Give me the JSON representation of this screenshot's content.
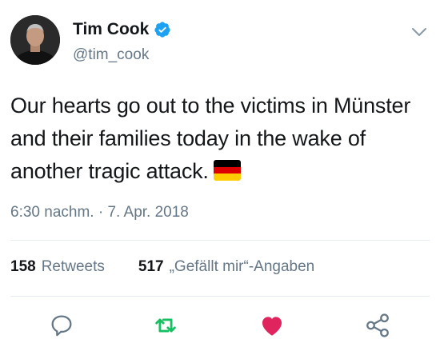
{
  "author": {
    "name": "Tim Cook",
    "handle": "@tim_cook",
    "verified": true
  },
  "tweet": {
    "text": "Our hearts go out to the victims in Münster and their families today in the wake of another tragic attack.",
    "emoji": "flag-germany",
    "timestamp": "6:30 nachm. · 7. Apr. 2018"
  },
  "stats": {
    "retweets_count": "158",
    "retweets_label": "Retweets",
    "likes_count": "517",
    "likes_label": "„Gefällt mir“-Angaben"
  },
  "actions": {
    "reply_icon": "reply-icon",
    "retweet_icon": "retweet-icon",
    "like_icon": "heart-icon",
    "share_icon": "share-icon"
  },
  "colors": {
    "verified": "#1da1f2",
    "retweet": "#17bf63",
    "like": "#e0245e",
    "secondary_text": "#657786",
    "flag_black": "#000000",
    "flag_red": "#dd0000",
    "flag_gold": "#ffce00"
  }
}
